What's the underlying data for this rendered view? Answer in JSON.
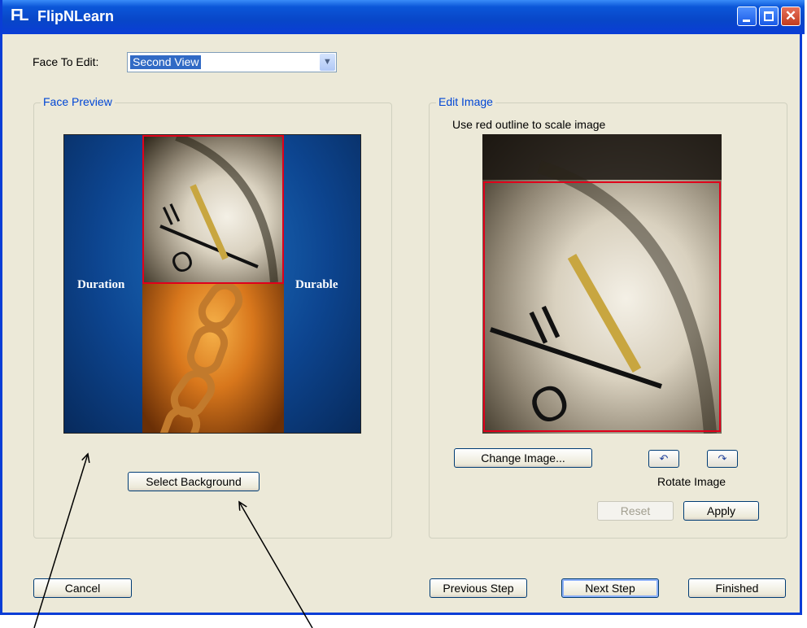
{
  "window": {
    "logo_text": "FL",
    "title": "FlipNLearn"
  },
  "face_select": {
    "label": "Face To Edit:",
    "value": "Second View"
  },
  "face_preview": {
    "group_label": "Face Preview",
    "left_caption": "Duration",
    "right_caption": "Durable",
    "select_background_label": "Select Background"
  },
  "edit_image": {
    "group_label": "Edit Image",
    "hint": "Use red outline to scale image",
    "change_image_label": "Change Image...",
    "rotate_left_icon": "rotate-left-icon",
    "rotate_right_icon": "rotate-right-icon",
    "rotate_label": "Rotate Image",
    "reset_label": "Reset",
    "apply_label": "Apply"
  },
  "footer": {
    "cancel_label": "Cancel",
    "previous_label": "Previous Step",
    "next_label": "Next Step",
    "finished_label": "Finished"
  },
  "colors": {
    "titlebar": "#0a3dd6",
    "accent_outline": "#e0001b",
    "group_label": "#0046d5"
  }
}
